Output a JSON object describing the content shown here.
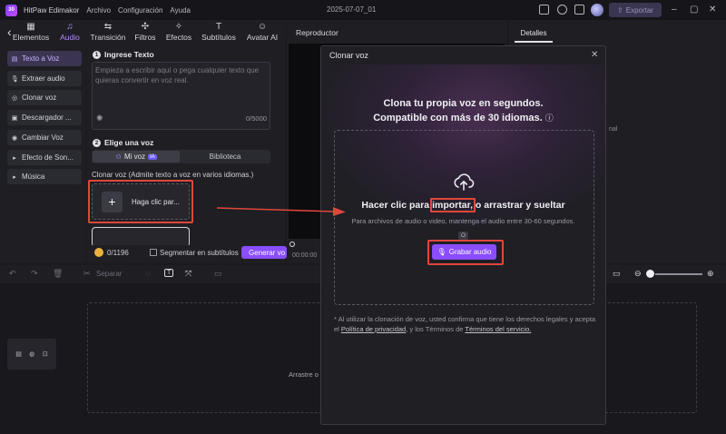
{
  "app": {
    "logo": "30",
    "title": "HitPaw Edimakor",
    "menus": [
      "Archivo",
      "Configuración",
      "Ayuda"
    ],
    "date": "2025-07-07_01",
    "export_label": "Exportar"
  },
  "tabs": [
    {
      "label": "Elementos",
      "icon": "grid-icon"
    },
    {
      "label": "Audio",
      "icon": "music-note-icon"
    },
    {
      "label": "Transición",
      "icon": "transition-icon"
    },
    {
      "label": "Filtros",
      "icon": "filter-icon"
    },
    {
      "label": "Efectos",
      "icon": "effects-icon"
    },
    {
      "label": "Subtítulos",
      "icon": "subtitles-icon"
    },
    {
      "label": "Avatar AI",
      "icon": "avatar-icon"
    }
  ],
  "sidebar": {
    "items": [
      {
        "label": "Texto a Voz",
        "icon": "tts-icon"
      },
      {
        "label": "Extraer audio",
        "icon": "mic-icon"
      },
      {
        "label": "Clonar voz",
        "icon": "clone-icon"
      },
      {
        "label": "Descargador ...",
        "icon": "download-icon"
      },
      {
        "label": "Cambiar Voz",
        "icon": "voice-change-icon"
      },
      {
        "label": "Efecto de Son...",
        "icon": "chevron-right-icon"
      },
      {
        "label": "Música",
        "icon": "chevron-right-icon"
      }
    ]
  },
  "tts": {
    "step1": "1",
    "section1": "Ingrese Texto",
    "placeholder": "Empieza a escribir aquí o pega cualquier texto que quieras convertir en voz real.",
    "counter": "0/5000",
    "step2": "2",
    "section2": "Elige una voz",
    "voice_tab1": "Mi voz",
    "ia_badge": "IA",
    "voice_tab2": "Biblioteca",
    "clone_label": "Clonar voz (Admite texto a voz en varios idiomas.)",
    "clone_btn": "Haga clic par...",
    "credits": "0/1196",
    "segment_label": "Segmentar en subtítulos",
    "generate": "Generar vo"
  },
  "player": {
    "title": "Reproductor",
    "time": "00:00:00"
  },
  "details": {
    "tab": "Detalles",
    "fragment": "nal"
  },
  "timeline": {
    "separar": "Separar",
    "drop_text": "Arrastre o"
  },
  "modal": {
    "title": "Clonar voz",
    "heading1": "Clona tu propia voz en segundos.",
    "heading2": "Compatible con más de 30 idiomas.",
    "import_pre": "Hacer clic para ",
    "import_word": "importar,",
    "import_post": " o arrastrar y sueltar",
    "import_sub": "Para archivos de audio o video, mantenga el audio entre 30-60 segundos.",
    "or": "O",
    "record": "Grabar audio",
    "disclaimer_1": "* Al utilizar la clonación de voz, usted confirma que tiene los derechos legales y acepta el ",
    "privacy": "Política de privacidad",
    "disclaimer_2": ", y los Términos de ",
    "terms": "Términos del servicio.",
    "disclaimer_3": " "
  },
  "colors": {
    "accent": "#8a4dff",
    "annotation": "#e0473b"
  }
}
